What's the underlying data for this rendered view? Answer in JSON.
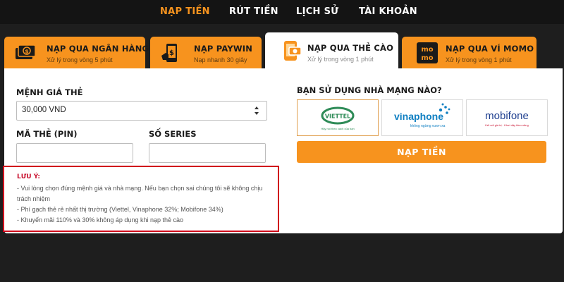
{
  "nav": {
    "items": [
      {
        "label": "NẠP TIỀN"
      },
      {
        "label": "RÚT TIỀN"
      },
      {
        "label": "LỊCH SỬ"
      },
      {
        "label": "TÀI KHOẢN"
      }
    ],
    "active_color": "#f7931e"
  },
  "tabs": [
    {
      "title": "NẠP QUA NGÂN HÀNG",
      "subtitle": "Xử lý trong vòng 5 phút",
      "icon": "cash-icon"
    },
    {
      "title": "NẠP PAYWIN",
      "subtitle": "Nạp nhanh 30 giây",
      "icon": "mobile-payment-icon"
    },
    {
      "title": "NẠP QUA THẺ CÀO",
      "subtitle": "Xử lý trong vòng 1 phút",
      "icon": "phone-card-icon"
    },
    {
      "title": "NẠP QUA VÍ MOMO",
      "subtitle": "Xử lý trong vòng 1 phút",
      "icon": "momo-logo",
      "logo_text": "MoMo"
    }
  ],
  "form": {
    "denomination_label": "MỆNH GIÁ THẺ",
    "denomination_value": "30,000 VND",
    "pin_label": "MÃ THẺ (PIN)",
    "pin_value": "",
    "serial_label": "SỐ SERIES",
    "serial_value": ""
  },
  "note": {
    "title": "LƯU Ý:",
    "lines": [
      "- Vui lòng chọn đúng mệnh giá và nhà mạng. Nếu bạn chọn sai chúng tôi sẽ không chịu",
      "trách nhiệm",
      "- Phí gạch thẻ rẻ nhất thị trường (Viettel, Vinaphone 32%; Mobifone 34%)",
      "- Khuyến mãi 110% và 30% không áp dụng khi nạp thẻ cào"
    ]
  },
  "carriers": {
    "label": "BẠN SỬ DỤNG NHÀ MẠNG NÀO?",
    "options": [
      {
        "name": "viettel",
        "logo_text": "VIETTEL",
        "tagline": "Hãy nói theo cách của bạn"
      },
      {
        "name": "vinaphone",
        "logo_text": "vinaphone",
        "tagline": "không ngừng vươn xa"
      },
      {
        "name": "mobifone",
        "logo_text": "mobifone",
        "tagline": "Kết nối giá trị - Khơi dậy tiềm năng"
      }
    ],
    "selected": "viettel"
  },
  "submit_label": "NẠP TIỀN",
  "colors": {
    "accent": "#f7931e",
    "background": "#1e1e1e",
    "warning": "#c8102e"
  }
}
